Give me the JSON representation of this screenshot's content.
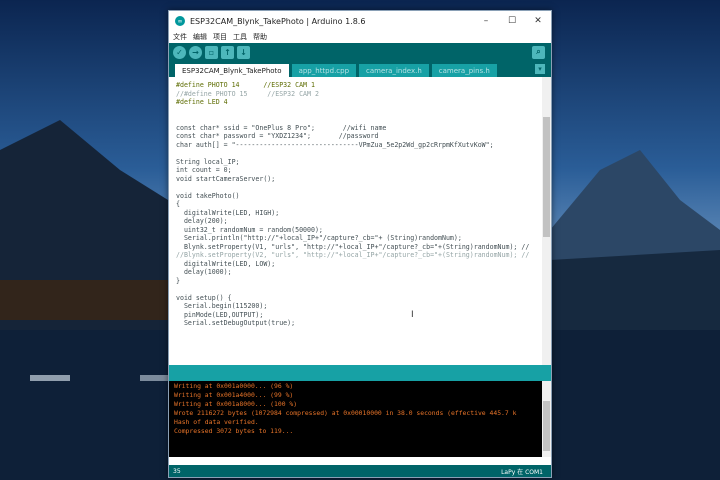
{
  "window": {
    "title": "ESP32CAM_Blynk_TakePhoto | Arduino 1.8.6",
    "minimize": "–",
    "maximize": "☐",
    "close": "✕"
  },
  "menu": [
    "文件",
    "编辑",
    "项目",
    "工具",
    "帮助"
  ],
  "toolbar": [
    "verify-icon",
    "upload-icon",
    "new-icon",
    "open-icon",
    "save-icon",
    "serial-monitor-icon"
  ],
  "tabs": [
    {
      "label": "ESP32CAM_Blynk_TakePhoto",
      "active": true
    },
    {
      "label": "app_httpd.cpp",
      "active": false
    },
    {
      "label": "camera_index.h",
      "active": false
    },
    {
      "label": "camera_pins.h",
      "active": false
    }
  ],
  "code_lines": [
    "#define PHOTO 14      //ESP32 CAM 1",
    "//#define PHOTO 15     //ESP32 CAM 2",
    "#define LED 4",
    "",
    "",
    "const char* ssid = \"OnePlus 8 Pro\";       //wifi name",
    "const char* password = \"YXDZ1234\";       //password",
    "char auth[] = \"-------------------------------VPmZua_5e2p2Wd_gp2cRrpmKfXutvKoW\";",
    "",
    "String local_IP;",
    "int count = 0;",
    "void startCameraServer();",
    "",
    "void takePhoto()",
    "{",
    "  digitalWrite(LED, HIGH);",
    "  delay(200);",
    "  uint32_t randomNum = random(50000);",
    "  Serial.println(\"http://\"+local_IP+\"/capture?_cb=\"+ (String)randomNum);",
    "  Blynk.setProperty(V1, \"urls\", \"http://\"+local_IP+\"/capture?_cb=\"+(String)randomNum); //",
    "//Blynk.setProperty(V2, \"urls\", \"http://\"+local_IP+\"/capture?_cb=\"+(String)randomNum); //",
    "  digitalWrite(LED, LOW);",
    "  delay(1000);",
    "}",
    "",
    "void setup() {",
    "  Serial.begin(115200);",
    "  pinMode(LED,OUTPUT);",
    "  Serial.setDebugOutput(true);"
  ],
  "console_lines": [
    "Writing at 0x001a0000... (96 %)",
    "Writing at 0x001a4000... (99 %)",
    "Writing at 0x001a8000... (100 %)",
    "Wrote 2116272 bytes (1072984 compressed) at 0x00010000 in 38.0 seconds (effective 445.7 k",
    "Hash of data verified.",
    "Compressed 3072 bytes to 119..."
  ],
  "status": {
    "line": "35",
    "board": "LaPy 在 COM1"
  }
}
